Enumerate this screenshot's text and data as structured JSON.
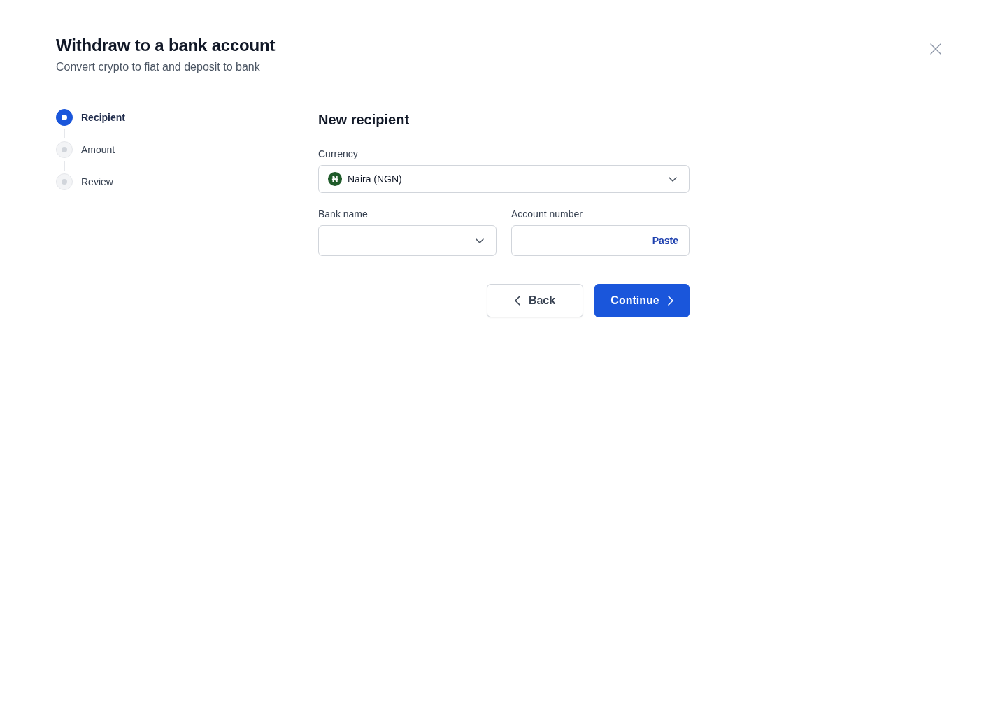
{
  "dialog": {
    "title": "Withdraw to a bank account",
    "subtitle": "Convert crypto to fiat and deposit to bank"
  },
  "steps": [
    {
      "label": "Recipient",
      "selected": true
    },
    {
      "label": "Amount",
      "selected": false
    },
    {
      "label": "Review",
      "selected": false
    }
  ],
  "form": {
    "heading": "New recipient",
    "currency": {
      "label": "Currency",
      "symbol": "₦",
      "value": "Naira (NGN)"
    },
    "bank_name": {
      "label": "Bank name"
    },
    "account_number": {
      "label": "Account number",
      "action": "Paste"
    }
  },
  "buttons": [
    {
      "label": "Back",
      "kind": "secondary"
    },
    {
      "label": "Continue",
      "kind": "primary"
    }
  ]
}
